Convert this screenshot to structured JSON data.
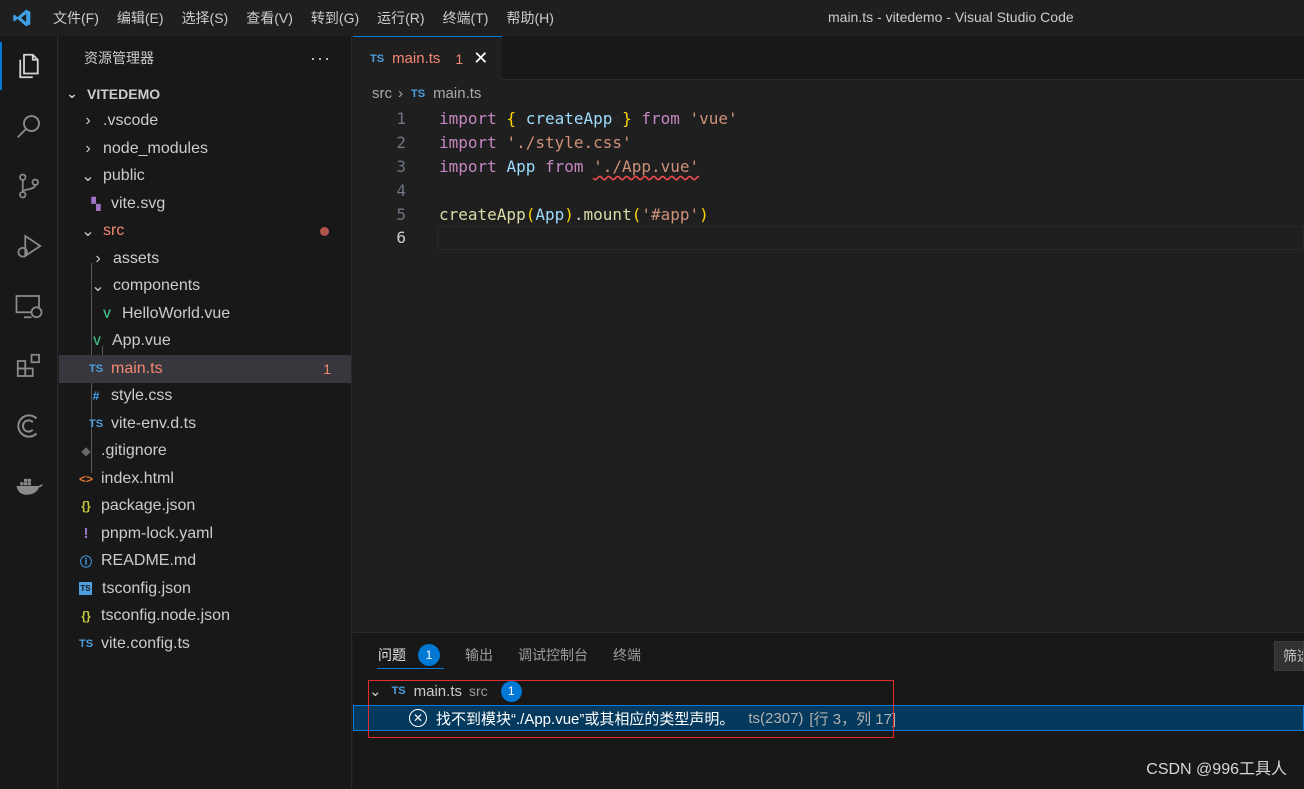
{
  "titlebar": {
    "menu": [
      "文件(F)",
      "编辑(E)",
      "选择(S)",
      "查看(V)",
      "转到(G)",
      "运行(R)",
      "终端(T)",
      "帮助(H)"
    ],
    "window_title": "main.ts - vitedemo - Visual Studio Code"
  },
  "activity_bar": {
    "icons": [
      "explorer-icon",
      "search-icon",
      "source-control-icon",
      "run-debug-icon",
      "remote-explorer-icon",
      "extensions-icon",
      "c-extension-icon",
      "docker-icon"
    ]
  },
  "sidebar": {
    "title": "资源管理器",
    "more": "···",
    "root": "VITEDEMO",
    "items": [
      {
        "label": ".vscode",
        "type": "folder",
        "expanded": false
      },
      {
        "label": "node_modules",
        "type": "folder",
        "expanded": false
      },
      {
        "label": "public",
        "type": "folder",
        "expanded": true
      },
      {
        "label": "vite.svg",
        "type": "svg"
      },
      {
        "label": "src",
        "type": "folder",
        "expanded": true,
        "error": true
      },
      {
        "label": "assets",
        "type": "folder",
        "expanded": false
      },
      {
        "label": "components",
        "type": "folder",
        "expanded": true
      },
      {
        "label": "HelloWorld.vue",
        "type": "vue"
      },
      {
        "label": "App.vue",
        "type": "vue"
      },
      {
        "label": "main.ts",
        "type": "ts",
        "badge": "1",
        "error": true,
        "selected": true
      },
      {
        "label": "style.css",
        "type": "css"
      },
      {
        "label": "vite-env.d.ts",
        "type": "ts"
      },
      {
        "label": ".gitignore",
        "type": "git"
      },
      {
        "label": "index.html",
        "type": "html"
      },
      {
        "label": "package.json",
        "type": "json"
      },
      {
        "label": "pnpm-lock.yaml",
        "type": "yaml"
      },
      {
        "label": "README.md",
        "type": "info"
      },
      {
        "label": "tsconfig.json",
        "type": "tsconfig"
      },
      {
        "label": "tsconfig.node.json",
        "type": "json"
      },
      {
        "label": "vite.config.ts",
        "type": "ts"
      }
    ]
  },
  "tabs": [
    {
      "icon": "TS",
      "label": "main.ts",
      "problems": "1",
      "close": "✕"
    }
  ],
  "breadcrumb": {
    "folder": "src",
    "sep": "›",
    "icon": "TS",
    "file": "main.ts"
  },
  "editor": {
    "line_numbers": [
      "1",
      "2",
      "3",
      "4",
      "5",
      "6"
    ],
    "lines": [
      "import { createApp } from 'vue'",
      "import './style.css'",
      "import App from './App.vue'",
      "",
      "createApp(App).mount('#app')",
      ""
    ],
    "current_line": 6
  },
  "panel": {
    "tabs": [
      "问题",
      "输出",
      "调试控制台",
      "终端"
    ],
    "problems_count": "1",
    "filter_label": "筛选",
    "file_group": {
      "icon": "TS",
      "file": "main.ts",
      "folder": "src",
      "count": "1"
    },
    "problem": {
      "message": "找不到模块“./App.vue”或其相应的类型声明。",
      "code": "ts(2307)",
      "position": "[行 3，列 17]"
    }
  },
  "watermark": "CSDN @996工具人",
  "colors": {
    "accent": "#0078d4",
    "error": "#f48771",
    "highlight_box": "#e52b2b"
  }
}
